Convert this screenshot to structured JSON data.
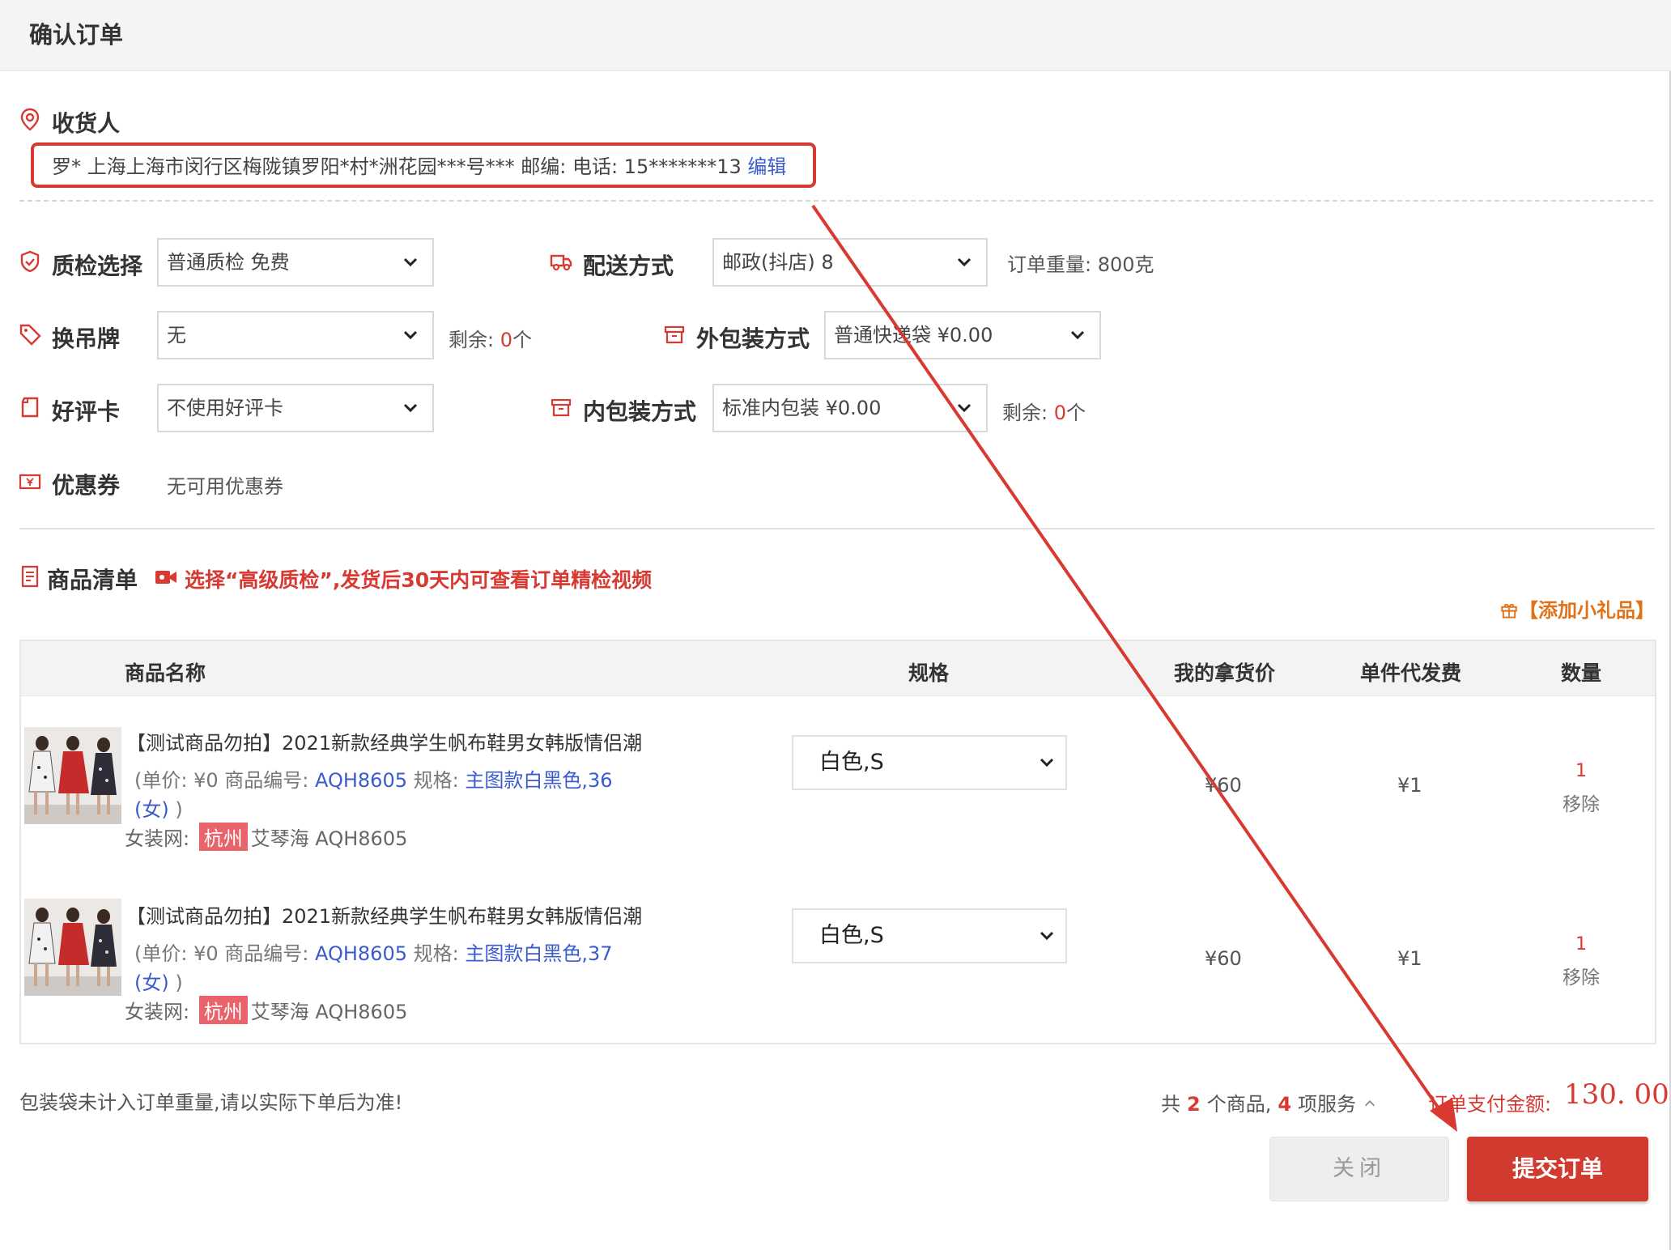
{
  "title": "确认订单",
  "receiver": {
    "label": "收货人",
    "address": "罗* 上海上海市闵行区梅陇镇罗阳*村*洲花园***号*** 邮编:  电话: 15*******13",
    "edit_label": "编辑"
  },
  "options": {
    "inspection": {
      "label": "质检选择",
      "value": "普通质检    免费"
    },
    "delivery": {
      "label": "配送方式",
      "value": "邮政(抖店) 8"
    },
    "weight": {
      "text": "订单重量: 800克"
    },
    "tag": {
      "label": "换吊牌",
      "value": "无"
    },
    "tag_remaining": {
      "prefix": "剩余: ",
      "count": "0",
      "unit": "个"
    },
    "outer_pack": {
      "label": "外包装方式",
      "value": "普通快递袋 ¥0.00"
    },
    "review_card": {
      "label": "好评卡",
      "value": "不使用好评卡"
    },
    "inner_pack": {
      "label": "内包装方式",
      "value": "标准内包装 ¥0.00"
    },
    "inner_remaining": {
      "prefix": "剩余: ",
      "count": "0",
      "unit": "个"
    },
    "coupon": {
      "label": "优惠券",
      "value": "无可用优惠券"
    }
  },
  "goods": {
    "title": "商品清单",
    "notice": "选择“高级质检”,发货后30天内可查看订单精检视频",
    "gift_label": "【添加小礼品】",
    "columns": [
      "商品名称",
      "规格",
      "我的拿货价",
      "单件代发费",
      "数量"
    ],
    "items": [
      {
        "title": "【测试商品勿拍】2021新款经典学生帆布鞋男女韩版情侣潮",
        "meta": "(单价: ¥0   商品编号: ",
        "code": "AQH8605",
        "spec_prefix": "  规格: ",
        "spec": "主图款白黑色,36",
        "spec2": "(女)",
        "close_paren": " )",
        "source_prefix": "女装网: ",
        "city": "杭州",
        "shop": "艾琴海 AQH8605",
        "selected_spec": "白色,S",
        "price": "¥60",
        "fee": "¥1",
        "qty": "1",
        "remove": "移除"
      },
      {
        "title": "【测试商品勿拍】2021新款经典学生帆布鞋男女韩版情侣潮",
        "meta": "(单价: ¥0   商品编号: ",
        "code": "AQH8605",
        "spec_prefix": "  规格: ",
        "spec": "主图款白黑色,37",
        "spec2": "(女)",
        "close_paren": " )",
        "source_prefix": "女装网: ",
        "city": "杭州",
        "shop": "艾琴海 AQH8605",
        "selected_spec": "白色,S",
        "price": "¥60",
        "fee": "¥1",
        "qty": "1",
        "remove": "移除"
      }
    ]
  },
  "footer": {
    "note": "包装袋未计入订单重量,请以实际下单后为准!",
    "summary_prefix": "共",
    "goods_count": "2",
    "goods_unit": "个商品,",
    "service_count": "4",
    "service_unit": "项服务",
    "pay_label": "订单支付金额:",
    "pay_amount": "130. 00",
    "close_button": "关闭",
    "submit_button": "提交订单"
  },
  "colors": {
    "accent_red": "#d83a32",
    "link_blue": "#3b5bcc",
    "orange": "#e0731a"
  }
}
